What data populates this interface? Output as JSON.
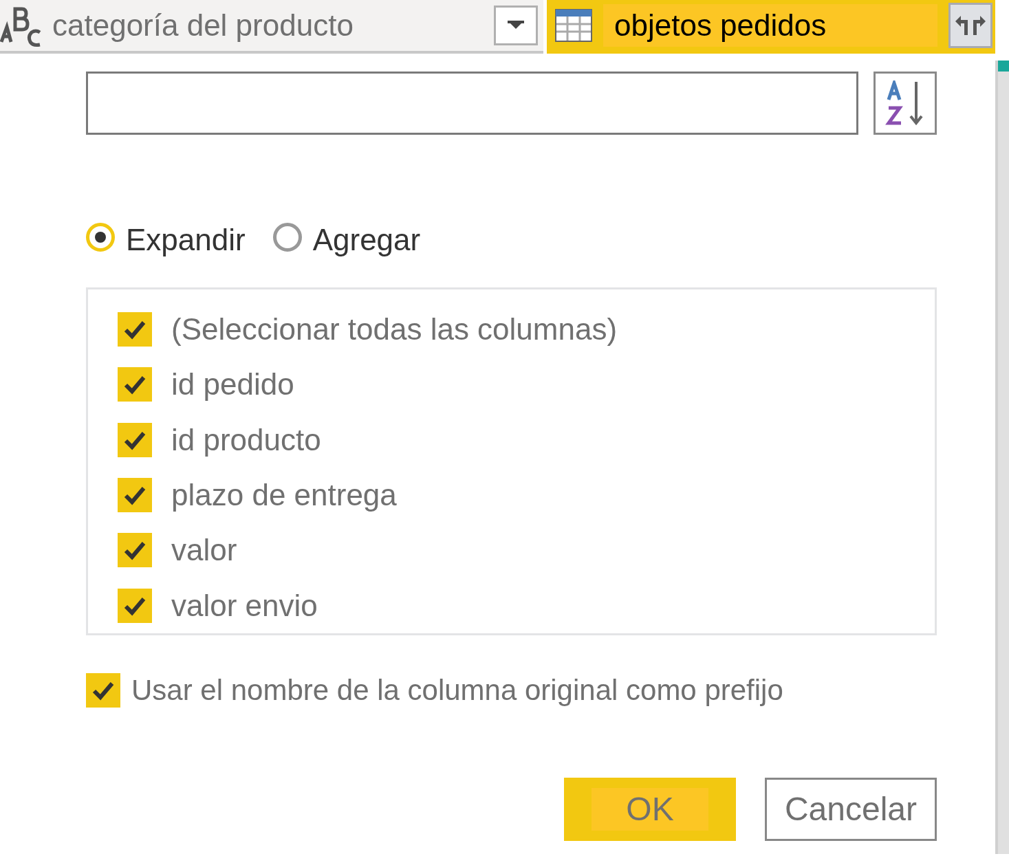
{
  "column_headers": [
    {
      "label": "categoría del producto",
      "kind": "text",
      "selected": false
    },
    {
      "label": "objetos pedidos",
      "kind": "table",
      "selected": true
    }
  ],
  "mode_options": [
    {
      "label": "Expandir",
      "selected": true
    },
    {
      "label": "Agregar",
      "selected": false
    }
  ],
  "column_list": [
    {
      "label": "(Seleccionar todas las columnas)",
      "checked": true
    },
    {
      "label": "id pedido",
      "checked": true
    },
    {
      "label": "id producto",
      "checked": true
    },
    {
      "label": "plazo de entrega",
      "checked": true
    },
    {
      "label": "valor",
      "checked": true
    },
    {
      "label": "valor envio",
      "checked": true
    }
  ],
  "prefix_option": {
    "label": "Usar el nombre de la columna original como prefijo",
    "checked": true
  },
  "buttons": [
    {
      "label": "OK",
      "kind": "primary"
    },
    {
      "label": "Cancelar",
      "kind": "secondary"
    }
  ]
}
